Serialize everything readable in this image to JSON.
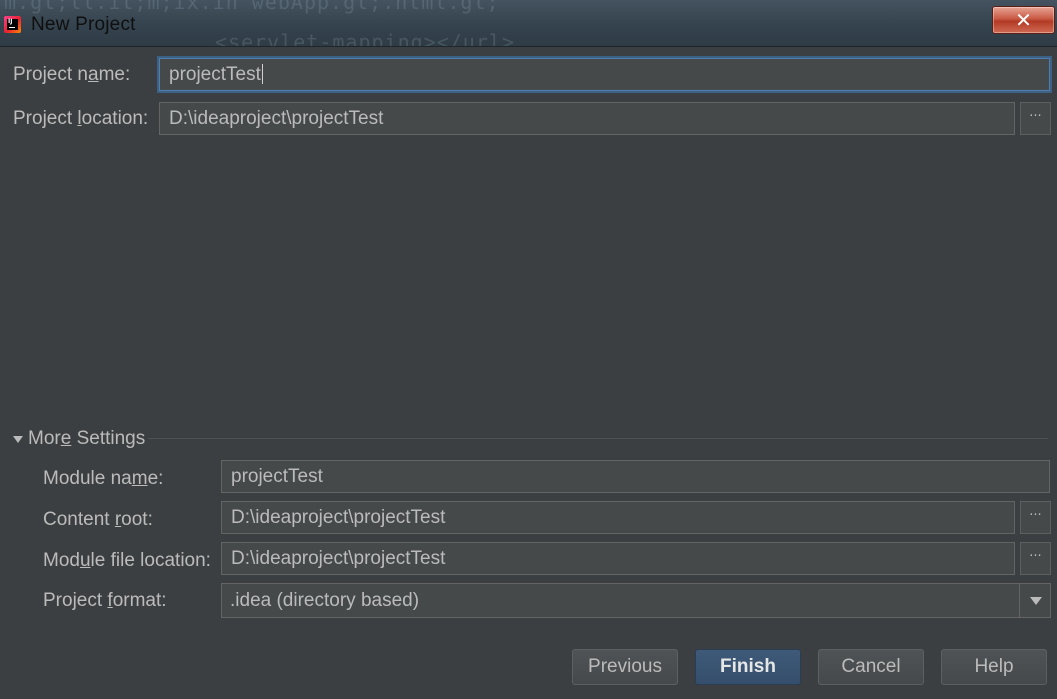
{
  "window": {
    "title": "New Project",
    "close_glyph": "✕",
    "background_code_1": "m.gt;ll.it;m;ix.in webApp.gt;.html.gt;",
    "background_code_2": "<servlet-mapping></url>",
    "accent_color": "#4f7dae"
  },
  "project": {
    "name_label_pre": "Project n",
    "name_label_ul": "a",
    "name_label_post": "me:",
    "name_value": "projectTest",
    "location_label_pre": "Project ",
    "location_label_ul": "l",
    "location_label_post": "ocation:",
    "location_value": "D:\\ideaproject\\projectTest",
    "browse_glyph": "···"
  },
  "more_settings": {
    "title_pre": "Mor",
    "title_ul": "e",
    "title_post": " Settings",
    "expanded": true,
    "module_name_label_pre": "Module na",
    "module_name_label_ul": "m",
    "module_name_label_post": "e:",
    "module_name_value": "projectTest",
    "content_root_label_pre": "Content ",
    "content_root_label_ul": "r",
    "content_root_label_post": "oot:",
    "content_root_value": "D:\\ideaproject\\projectTest",
    "module_file_label_pre": "Mod",
    "module_file_label_ul": "u",
    "module_file_label_post": "le file location:",
    "module_file_value": "D:\\ideaproject\\projectTest",
    "project_format_label_pre": "Project ",
    "project_format_label_ul": "f",
    "project_format_label_post": "ormat:",
    "project_format_value": ".idea (directory based)"
  },
  "buttons": {
    "previous": "Previous",
    "finish": "Finish",
    "cancel": "Cancel",
    "help": "Help"
  }
}
